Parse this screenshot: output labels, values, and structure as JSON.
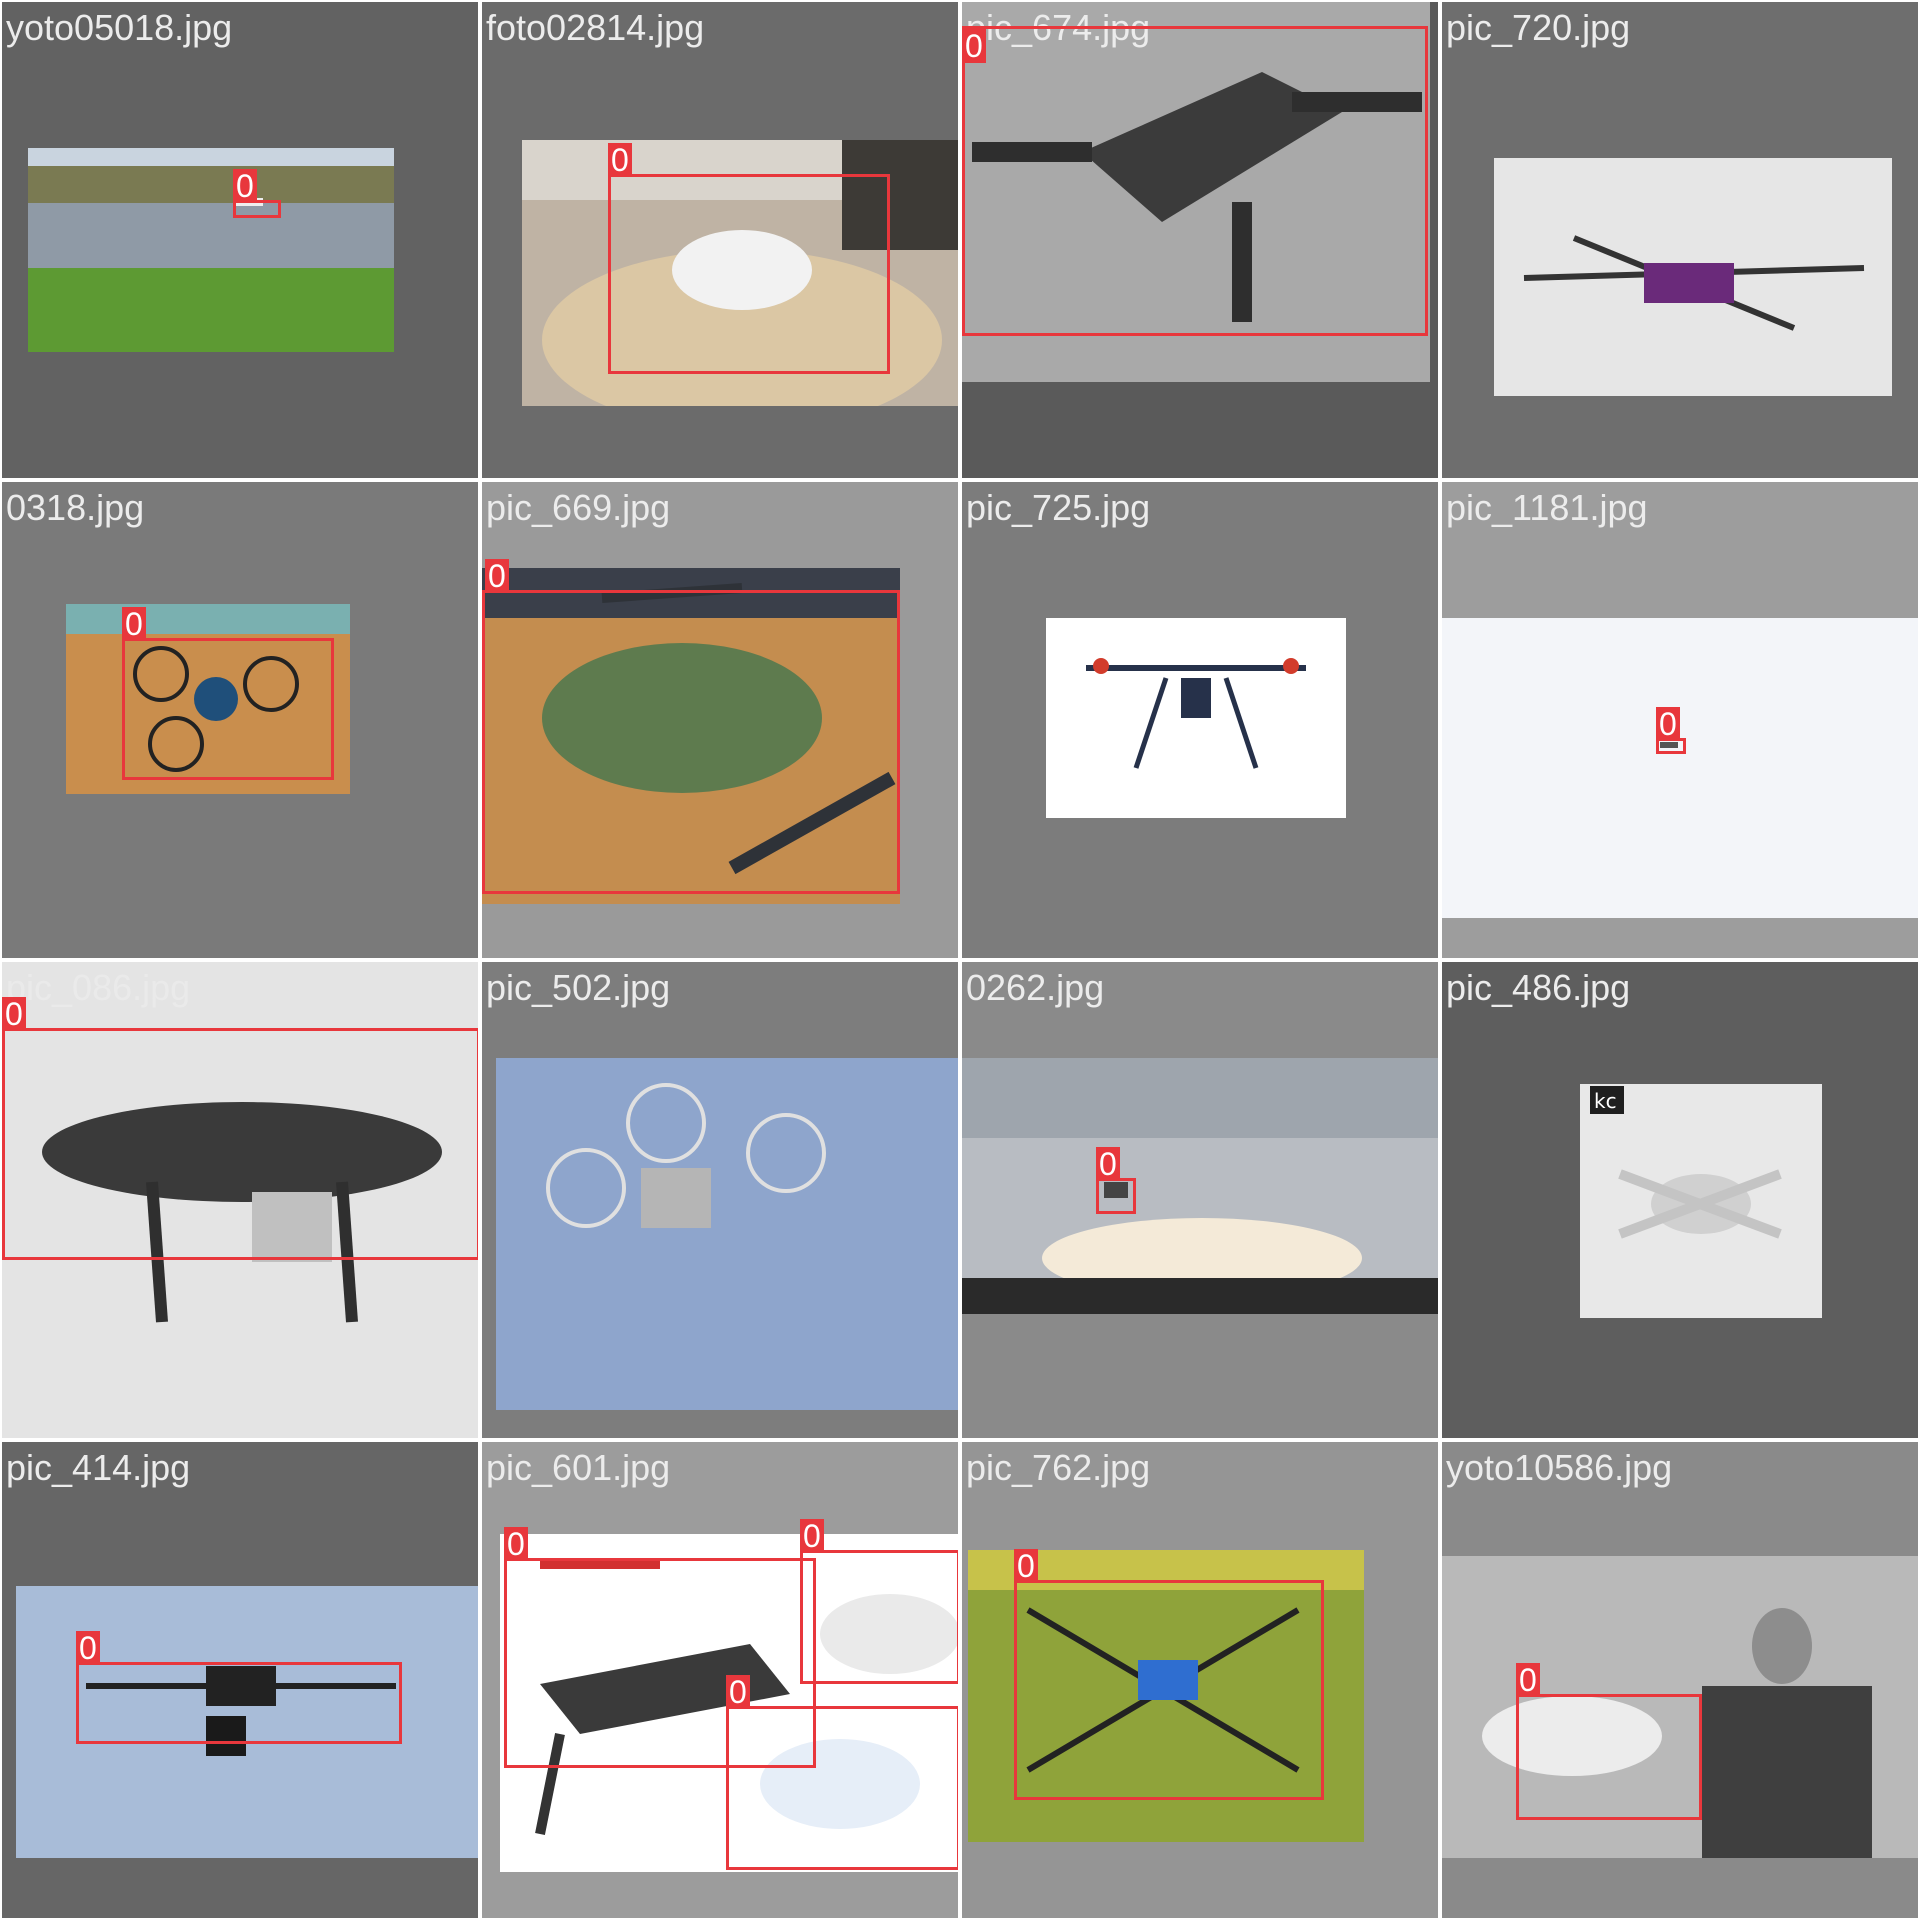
{
  "grid": {
    "tiles": [
      {
        "filename": "yoto05018.jpg",
        "background": "#626262",
        "boxes": [
          {
            "class_label": "0"
          }
        ]
      },
      {
        "filename": "foto02814.jpg",
        "background": "#6b6b6b",
        "boxes": [
          {
            "class_label": "0"
          }
        ]
      },
      {
        "filename": "pic_674.jpg",
        "background": "#5a5a5a",
        "boxes": [
          {
            "class_label": "0"
          }
        ]
      },
      {
        "filename": "pic_720.jpg",
        "background": "#6e6e6e",
        "boxes": []
      },
      {
        "filename": "0318.jpg",
        "background": "#7a7a7a",
        "boxes": [
          {
            "class_label": "0"
          }
        ]
      },
      {
        "filename": "pic_669.jpg",
        "background": "#9a9a9a",
        "boxes": [
          {
            "class_label": "0"
          }
        ]
      },
      {
        "filename": "pic_725.jpg",
        "background": "#7c7c7c",
        "boxes": []
      },
      {
        "filename": "pic_1181.jpg",
        "background": "#9d9d9d",
        "boxes": [
          {
            "class_label": "0"
          }
        ]
      },
      {
        "filename": "pic_086.jpg",
        "background": "#e4e4e4",
        "boxes": [
          {
            "class_label": "0"
          }
        ]
      },
      {
        "filename": "pic_502.jpg",
        "background": "#7d7d7d",
        "boxes": []
      },
      {
        "filename": "0262.jpg",
        "background": "#8a8a8a",
        "boxes": [
          {
            "class_label": "0"
          }
        ]
      },
      {
        "filename": "pic_486.jpg",
        "background": "#5e5e5e",
        "boxes": []
      },
      {
        "filename": "pic_414.jpg",
        "background": "#666666",
        "boxes": [
          {
            "class_label": "0"
          }
        ]
      },
      {
        "filename": "pic_601.jpg",
        "background": "#9c9c9c",
        "boxes": [
          {
            "class_label": "0"
          },
          {
            "class_label": "0"
          },
          {
            "class_label": "0"
          }
        ]
      },
      {
        "filename": "pic_762.jpg",
        "background": "#959595",
        "boxes": [
          {
            "class_label": "0"
          }
        ]
      },
      {
        "filename": "yoto10586.jpg",
        "background": "#8a8a8a",
        "boxes": [
          {
            "class_label": "0"
          }
        ]
      }
    ]
  },
  "colors": {
    "box_color": "#e8373c",
    "label_text": "#ececec"
  },
  "photo_logo_text": "kc"
}
